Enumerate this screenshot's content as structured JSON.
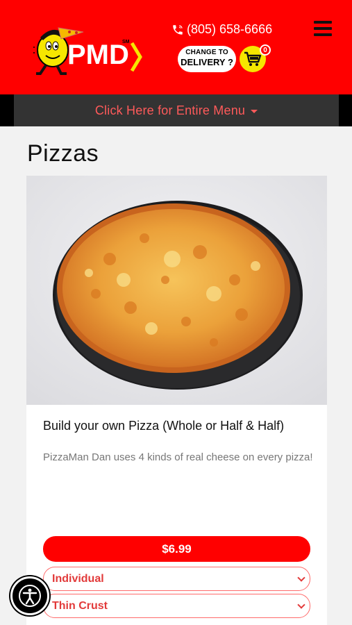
{
  "header": {
    "brand": "PMD",
    "brand_mark": "SM",
    "phone": "(805) 658-6666",
    "delivery_line1": "CHANGE TO",
    "delivery_line2": "DELIVERY ?",
    "cart_count": "0",
    "icons": [
      "phone-icon",
      "hamburger-menu-icon",
      "cart-icon"
    ]
  },
  "menubar": {
    "label": "Click Here for Entire Menu"
  },
  "page": {
    "title": "Pizzas"
  },
  "product": {
    "title": "Build your own Pizza (Whole or Half & Half)",
    "description": "PizzaMan Dan uses 4 kinds of real cheese on every pizza!",
    "price": "$6.99",
    "size_selected": "Individual",
    "crust_selected": "Thin Crust"
  },
  "accessibility": {
    "icon": "accessibility-icon"
  },
  "colors": {
    "brand_red": "#ff0000",
    "cart_yellow": "#f6e600",
    "menubar_bg": "#333333",
    "menubar_text": "#ff5a5a"
  }
}
